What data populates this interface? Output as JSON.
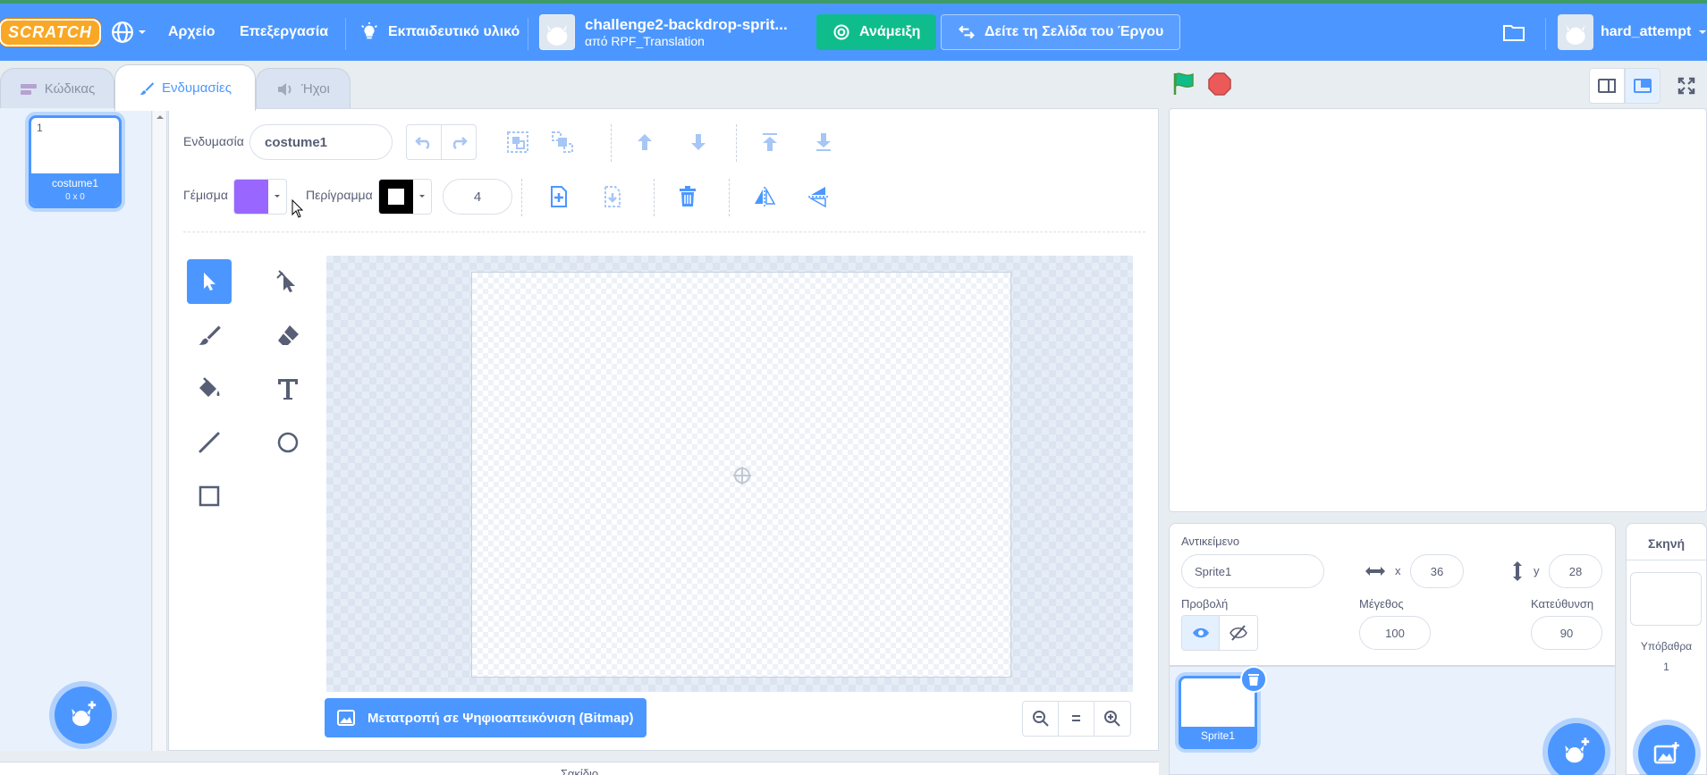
{
  "menubar": {
    "logo_text": "SCRATCH",
    "file": "Αρχείο",
    "edit": "Επεξεργασία",
    "tutorials": "Εκπαιδευτικό υλικό",
    "project_title": "challenge2-backdrop-sprit...",
    "project_by": "από RPF_Translation",
    "remix": "Ανάμειξη",
    "see_project_page": "Δείτε τη Σελίδα του Έργου",
    "username": "hard_attempt"
  },
  "tabs": {
    "code": "Κώδικας",
    "costumes": "Ενδυμασίες",
    "sounds": "Ήχοι"
  },
  "costume_list": {
    "items": [
      {
        "number": "1",
        "name": "costume1",
        "size": "0 x 0"
      }
    ]
  },
  "editor": {
    "costume_label": "Ενδυμασία",
    "costume_name": "costume1",
    "fill_label": "Γέμισμα",
    "outline_label": "Περίγραμμα",
    "outline_width": "4",
    "fill_color": "#9966ff",
    "outline_color": "#000000",
    "convert_bitmap": "Μετατροπή σε Ψηφιοαπεικόνιση (Bitmap)",
    "zoom_reset": "="
  },
  "sprite_info": {
    "sprite_label": "Αντικείμενο",
    "sprite_name": "Sprite1",
    "x_label": "x",
    "x_value": "36",
    "y_label": "y",
    "y_value": "28",
    "show_label": "Προβολή",
    "size_label": "Μέγεθος",
    "size_value": "100",
    "direction_label": "Κατεύθυνση",
    "direction_value": "90"
  },
  "sprites": [
    {
      "name": "Sprite1"
    }
  ],
  "stage_pane": {
    "title": "Σκηνή",
    "backdrops_label": "Υπόβαθρα",
    "backdrops_count": "1"
  },
  "backpack": "Σακίδιο",
  "colors": {
    "menubar": "#4c97ff",
    "remix": "#0fbd8c",
    "accent": "#4c97ff",
    "green_flag": "#0fbd8c",
    "stop": "#ec5959"
  }
}
